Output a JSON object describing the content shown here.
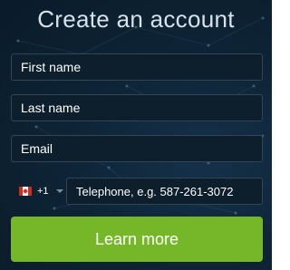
{
  "title": "Create an account",
  "fields": {
    "first_name_placeholder": "First name",
    "last_name_placeholder": "Last name",
    "email_placeholder": "Email",
    "phone_placeholder": "Telephone, e.g. 587-261-3072"
  },
  "country": {
    "flag": "canada-flag-icon",
    "dial_code": "+1"
  },
  "cta_label": "Learn more",
  "colors": {
    "background": "#0d2233",
    "field_bg": "#0d1e2d",
    "field_border": "#32465a",
    "accent": "#76b72a"
  }
}
